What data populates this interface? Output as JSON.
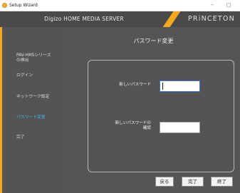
{
  "window": {
    "title": "Setup Wizard",
    "minimize_glyph": "–",
    "maximize_glyph": "□",
    "icon": "setup-app-icon"
  },
  "header": {
    "product": "Digizo HOME MEDIA SERVER",
    "brand": "PRiNCETON",
    "accent_color": "#f5a81c"
  },
  "sidebar": {
    "items": [
      {
        "label": "PAV-HMSシリーズ",
        "active": false
      },
      {
        "label": "の検出",
        "active": false
      },
      {
        "label": "ログイン",
        "active": false
      },
      {
        "label": "ネットワーク設定",
        "active": false
      },
      {
        "label": "パスワード変更",
        "active": true
      },
      {
        "label": "完了",
        "active": false
      }
    ],
    "active_color": "#4ab0e6"
  },
  "main": {
    "page_title": "パスワード変更",
    "fields": {
      "new_password": {
        "label": "新しいパスワード",
        "value": ""
      },
      "confirm_password": {
        "label_line1": "新しいパスワードの",
        "label_line2": "確認",
        "value": ""
      }
    }
  },
  "buttons": {
    "back": "戻る",
    "finish": "完了",
    "exit": "終了"
  }
}
